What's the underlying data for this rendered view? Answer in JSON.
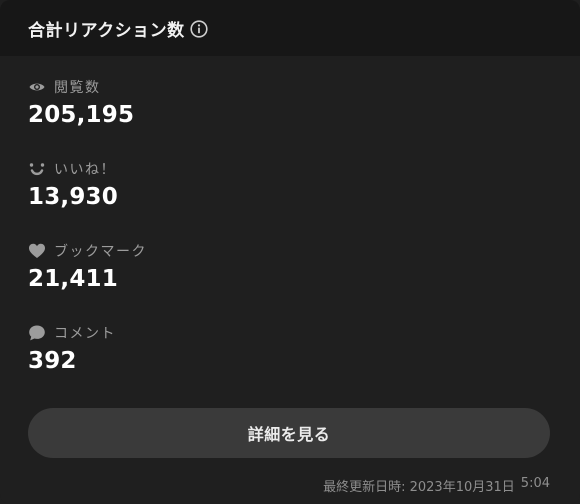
{
  "header": {
    "title": "合計リアクション数"
  },
  "stats": [
    {
      "label": "閲覧数",
      "value": "205,195"
    },
    {
      "label": "いいね！",
      "value": "13,930"
    },
    {
      "label": "ブックマーク",
      "value": "21,411"
    },
    {
      "label": "コメント",
      "value": "392"
    }
  ],
  "button": {
    "label": "詳細を見る"
  },
  "footer": {
    "updated_label": "最終更新日時: 2023年10月31日",
    "updated_time": "5:04"
  },
  "colors": {
    "background": "#1f1f1f",
    "header_background": "#171717",
    "button_background": "#3a3a3a",
    "label": "#9c9c9c",
    "value": "#ffffff"
  }
}
